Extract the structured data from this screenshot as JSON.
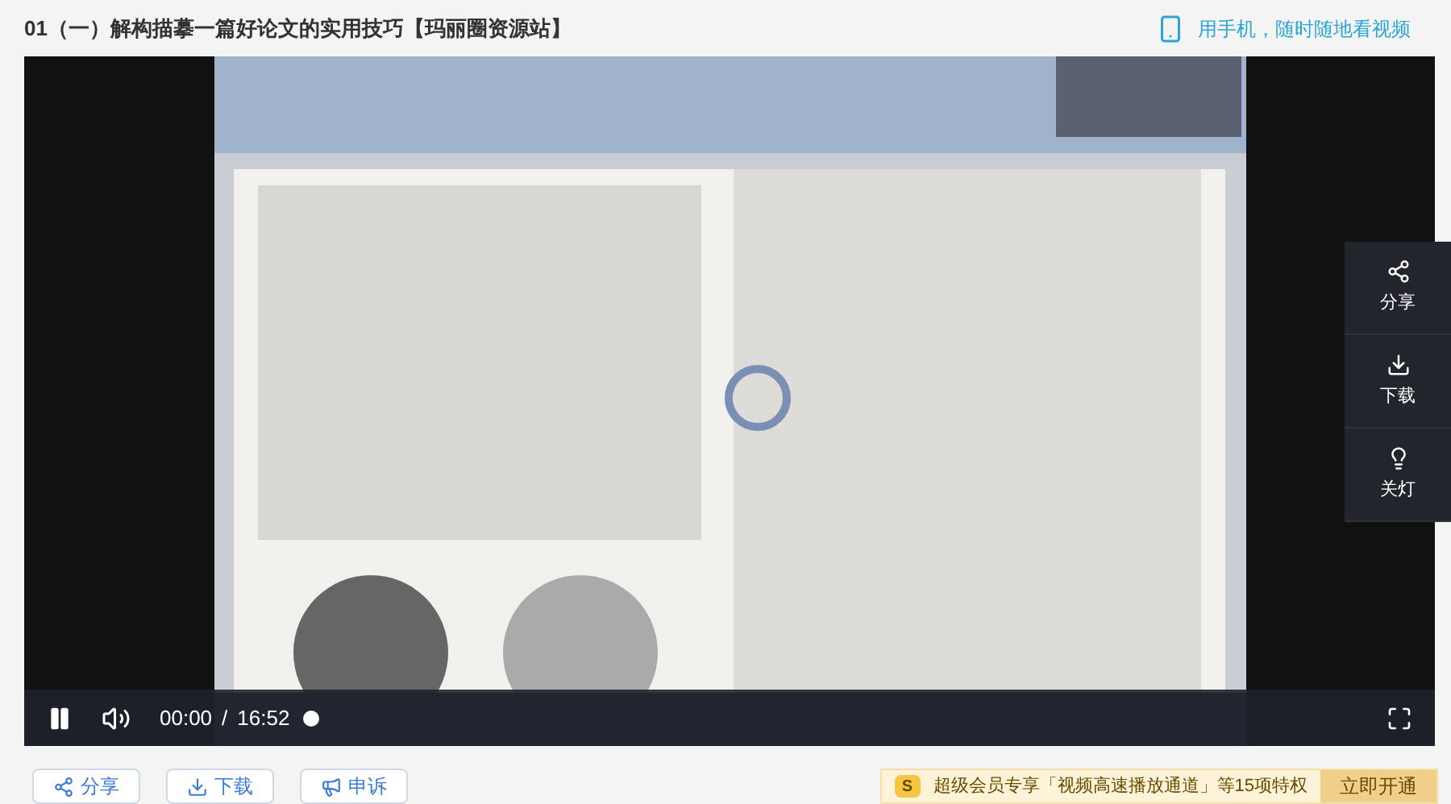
{
  "title": "01（一）解构描摹一篇好论文的实用技巧【玛丽圈资源站】",
  "mobile_link": "用手机，随时随地看视频",
  "video": {
    "kind": "picture",
    "playing": true,
    "time": "00:00",
    "separator": "/",
    "duration": "16:52",
    "level": 0
  },
  "side_actions": [
    {
      "kind": "share",
      "label": "分享"
    },
    {
      "kind": "download",
      "label": "下载"
    },
    {
      "kind": "light",
      "label": "关灯"
    }
  ],
  "actions": [
    {
      "kind": "share",
      "label": "分享"
    },
    {
      "kind": "download",
      "label": "下载"
    },
    {
      "kind": "report",
      "label": "申诉"
    }
  ],
  "promo": {
    "badge": "S",
    "text": "超级会员专享「视频高速播放通道」等15项特权",
    "button": "立即开通"
  }
}
